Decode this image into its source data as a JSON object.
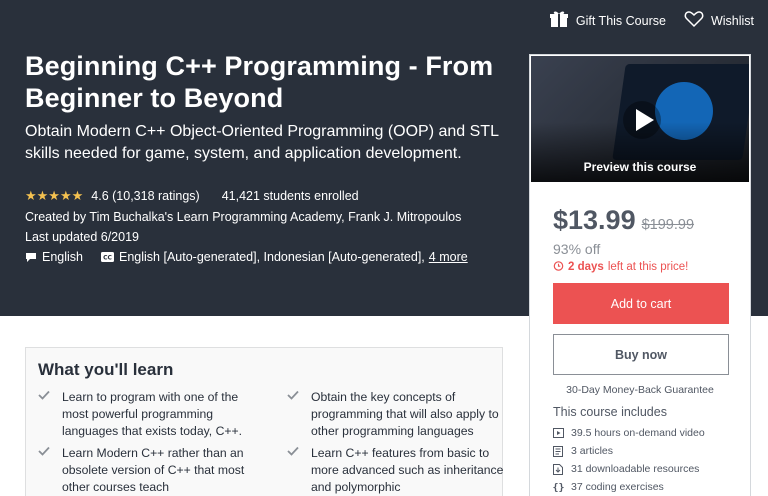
{
  "topbar": {
    "gift": "Gift This Course",
    "wishlist": "Wishlist"
  },
  "course": {
    "title": "Beginning C++ Programming - From Beginner to Beyond",
    "subtitle": "Obtain Modern C++ Object-Oriented Programming (OOP) and STL skills needed for game, system, and application development.",
    "rating_stars": "★★★★★",
    "rating": "4.6 (10,318 ratings)",
    "students": "41,421 students enrolled",
    "created_by": "Created by Tim Buchalka's Learn Programming Academy, Frank J. Mitropoulos",
    "last_updated": "Last updated 6/2019",
    "language": "English",
    "captions": "English [Auto-generated], Indonesian [Auto-generated],",
    "more_captions": "4 more"
  },
  "sidebar": {
    "preview_label": "Preview this course",
    "price": "$13.99",
    "original_price": "$199.99",
    "discount": "93% off",
    "timer_bold": "2 days",
    "timer_rest": "left at this price!",
    "add_to_cart": "Add to cart",
    "buy_now": "Buy now",
    "guarantee": "30-Day Money-Back Guarantee",
    "includes_title": "This course includes",
    "includes": [
      {
        "icon": "video-icon",
        "text": "39.5 hours on-demand video"
      },
      {
        "icon": "article-icon",
        "text": "3 articles"
      },
      {
        "icon": "download-icon",
        "text": "31 downloadable resources"
      },
      {
        "icon": "code-icon",
        "text": "37 coding exercises"
      }
    ]
  },
  "learn": {
    "title": "What you'll learn",
    "items": [
      "Learn to program with one of the most powerful programming languages that exists today, C++.",
      "Obtain the key concepts of programming that will also apply to other programming languages",
      "Learn Modern C++ rather than an obsolete version of C++ that most other courses teach",
      "Learn C++ features from basic to more advanced such as inheritance and polymorphic"
    ]
  },
  "colors": {
    "hero_bg": "#29303b",
    "accent_red": "#ec5252",
    "star": "#f4c150"
  }
}
